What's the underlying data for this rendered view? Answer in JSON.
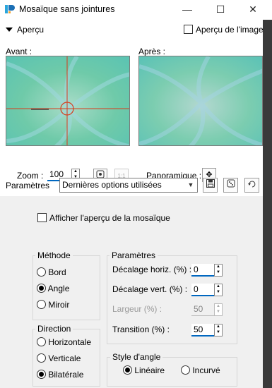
{
  "window": {
    "title": "Mosaïque sans jointures",
    "minimize_glyph": "—",
    "maximize_glyph": "☐",
    "close_glyph": "✕"
  },
  "apercu": {
    "toggle_label": "Aperçu",
    "image_checkbox_label": "Aperçu de l'image",
    "image_checked": false
  },
  "preview": {
    "before_label": "Avant :",
    "after_label": "Après :"
  },
  "zoom": {
    "label": "Zoom :",
    "value": "100"
  },
  "panoramique": {
    "label": "Panoramique :"
  },
  "parametres_row": {
    "label": "Paramètres",
    "selected": "Dernières options utilisées"
  },
  "mosaic_checkbox": {
    "label": "Afficher l'aperçu de la mosaïque",
    "checked": false
  },
  "methode": {
    "title": "Méthode",
    "options": [
      "Bord",
      "Angle",
      "Miroir"
    ],
    "selected": "Angle"
  },
  "direction": {
    "title": "Direction",
    "options": [
      "Horizontale",
      "Verticale",
      "Bilatérale"
    ],
    "selected": "Bilatérale"
  },
  "params": {
    "title": "Paramètres",
    "fields": [
      {
        "label": "Décalage horiz. (%) :",
        "value": "0",
        "enabled": true
      },
      {
        "label": "Décalage vert. (%) :",
        "value": "0",
        "enabled": true
      },
      {
        "label": "Largeur (%) :",
        "value": "50",
        "enabled": false
      },
      {
        "label": "Transition (%) :",
        "value": "50",
        "enabled": true
      }
    ]
  },
  "style_angle": {
    "title": "Style d'angle",
    "options": [
      "Linéaire",
      "Incurvé"
    ],
    "selected": "Linéaire"
  },
  "colors": {
    "accent": "#0067c0",
    "preview_base": "#6fcaa9",
    "crosshair": "#d83a1a"
  }
}
